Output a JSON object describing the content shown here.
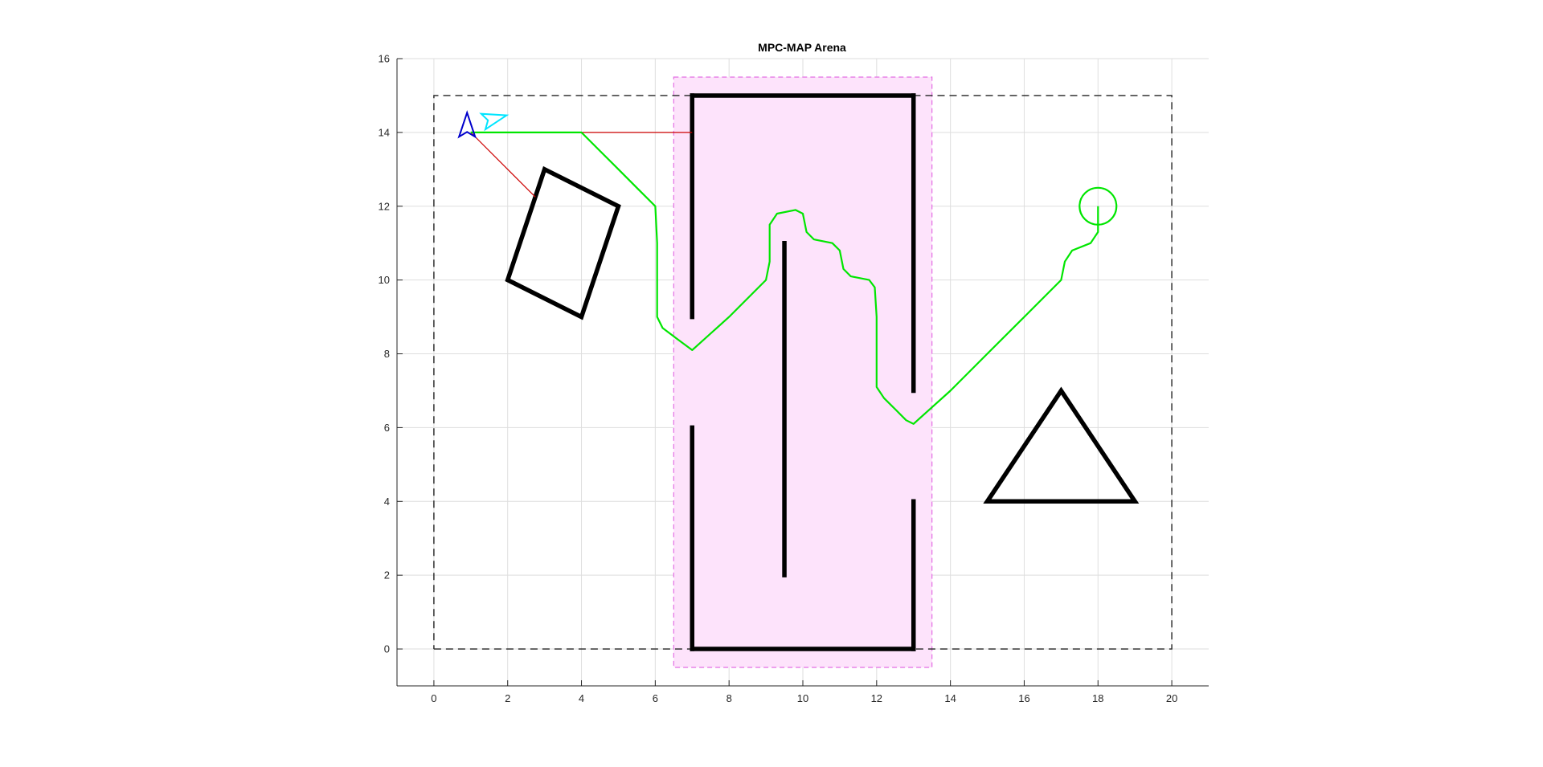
{
  "chart_data": {
    "type": "scatter",
    "title": "MPC-MAP Arena",
    "xlabel": "",
    "ylabel": "",
    "xlim": [
      -1,
      21
    ],
    "ylim": [
      -1,
      16
    ],
    "grid": true,
    "xticks": [
      0,
      2,
      4,
      6,
      8,
      10,
      12,
      14,
      16,
      18,
      20
    ],
    "yticks": [
      0,
      2,
      4,
      6,
      8,
      10,
      12,
      14,
      16
    ],
    "arena_boundary": [
      [
        0,
        0
      ],
      [
        20,
        0
      ],
      [
        20,
        15
      ],
      [
        0,
        15
      ],
      [
        0,
        0
      ]
    ],
    "shaded_zone": {
      "x": [
        6.5,
        13.5
      ],
      "y": [
        -0.5,
        15.5
      ],
      "fill": "#fde3fb",
      "edge": "#e36ee3"
    },
    "walls": [
      [
        [
          7,
          15
        ],
        [
          13,
          15
        ]
      ],
      [
        [
          7,
          15
        ],
        [
          7,
          9
        ]
      ],
      [
        [
          13,
          15
        ],
        [
          13,
          7
        ]
      ],
      [
        [
          7,
          6
        ],
        [
          7,
          0
        ]
      ],
      [
        [
          7,
          0
        ],
        [
          13,
          0
        ]
      ],
      [
        [
          13,
          0
        ],
        [
          13,
          4
        ]
      ],
      [
        [
          9.5,
          11
        ],
        [
          9.5,
          2
        ]
      ]
    ],
    "obstacles": [
      {
        "shape": "rectangle",
        "points": [
          [
            3,
            13
          ],
          [
            5,
            12
          ],
          [
            4,
            9
          ],
          [
            2,
            10
          ]
        ]
      },
      {
        "shape": "triangle",
        "points": [
          [
            15,
            4
          ],
          [
            19,
            4
          ],
          [
            17,
            7
          ]
        ]
      }
    ],
    "goal": {
      "x": 18,
      "y": 12,
      "r": 0.5
    },
    "planned_path": [
      [
        1,
        14
      ],
      [
        3,
        14
      ],
      [
        4,
        14
      ],
      [
        4.5,
        13.5
      ],
      [
        5,
        13
      ],
      [
        5.5,
        12.5
      ],
      [
        6,
        12
      ],
      [
        6.05,
        11
      ],
      [
        6.05,
        9
      ],
      [
        6.2,
        8.7
      ],
      [
        6.6,
        8.4
      ],
      [
        7,
        8.1
      ],
      [
        8,
        9
      ],
      [
        9,
        10
      ],
      [
        9.1,
        10.5
      ],
      [
        9.1,
        11.5
      ],
      [
        9.3,
        11.8
      ],
      [
        9.8,
        11.9
      ],
      [
        10,
        11.8
      ],
      [
        10.1,
        11.3
      ],
      [
        10.3,
        11.1
      ],
      [
        10.8,
        11
      ],
      [
        11,
        10.8
      ],
      [
        11.1,
        10.3
      ],
      [
        11.3,
        10.1
      ],
      [
        11.8,
        10
      ],
      [
        11.95,
        9.8
      ],
      [
        12,
        9
      ],
      [
        12,
        7.1
      ],
      [
        12.2,
        6.8
      ],
      [
        12.5,
        6.5
      ],
      [
        12.8,
        6.2
      ],
      [
        13,
        6.1
      ],
      [
        14,
        7
      ],
      [
        15,
        8
      ],
      [
        16,
        9
      ],
      [
        17,
        10
      ],
      [
        17.1,
        10.5
      ],
      [
        17.3,
        10.8
      ],
      [
        17.8,
        11
      ],
      [
        18,
        11.3
      ],
      [
        18,
        12
      ]
    ],
    "sensor_rays": [
      [
        [
          1,
          14
        ],
        [
          7,
          14
        ]
      ],
      [
        [
          1,
          14
        ],
        [
          2.75,
          12.25
        ]
      ]
    ],
    "robot": {
      "position": [
        1,
        14
      ],
      "heading_deg": 90,
      "estimate_heading_deg": 15
    },
    "colors": {
      "path": "#00e600",
      "walls": "#000000",
      "sensor_ray": "#cc0000",
      "robot": "#0000cc",
      "robot_estimate": "#00e5ff",
      "boundary": "#222222",
      "grid": "#dedede",
      "axis": "#262626"
    }
  }
}
